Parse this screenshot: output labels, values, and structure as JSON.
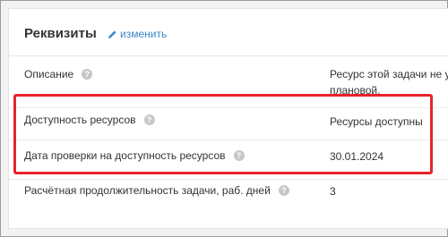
{
  "card": {
    "title": "Реквизиты",
    "edit_label": "изменить"
  },
  "rows": [
    {
      "label": "Описание",
      "value_line1": "Ресурс этой задачи не учтен",
      "value_line2": "плановой."
    },
    {
      "label": "Доступность ресурсов",
      "value": "Ресурсы доступны"
    },
    {
      "label": "Дата проверки на доступность ресурсов",
      "value": "30.01.2024"
    },
    {
      "label": "Расчётная продолжительность задачи, раб. дней",
      "value": "3"
    }
  ],
  "help_glyph": "?",
  "colors": {
    "link": "#3b86c6",
    "highlight": "#e8232b",
    "help_icon": "#c7c7c7"
  }
}
